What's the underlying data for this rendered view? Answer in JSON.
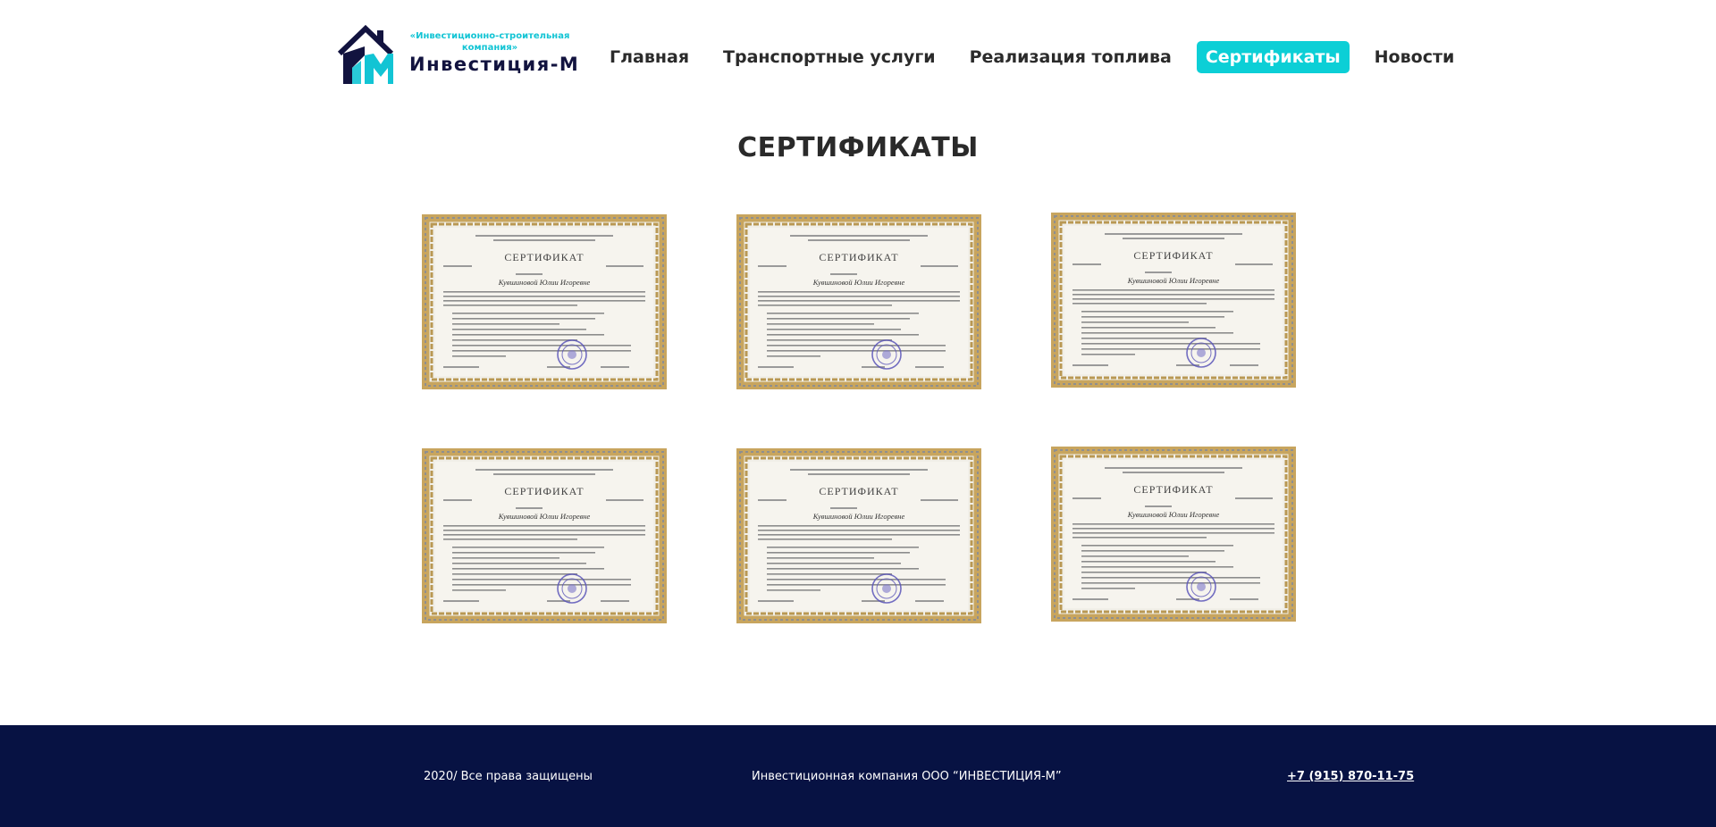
{
  "header": {
    "logo": {
      "subtitle": "«Инвестиционно-строительная компания»",
      "name": "Инвестиция-М"
    },
    "nav": [
      {
        "label": "Главная",
        "active": false
      },
      {
        "label": "Транспортные услуги",
        "active": false
      },
      {
        "label": "Реализация топлива",
        "active": false
      },
      {
        "label": "Сертификаты",
        "active": true
      },
      {
        "label": "Новости",
        "active": false
      }
    ]
  },
  "main": {
    "title": "СЕРТИФИКАТЫ",
    "certificates": [
      {
        "heading": "СЕРТИФИКАТ",
        "name": "Кувшиновой Юлии Игоревне"
      },
      {
        "heading": "СЕРТИФИКАТ",
        "name": "Кувшиновой Юлии Игоревне"
      },
      {
        "heading": "СЕРТИФИКАТ",
        "name": "Кувшиновой Юлии Игоревне"
      },
      {
        "heading": "СЕРТИФИКАТ",
        "name": "Кувшиновой Юлии Игоревне"
      },
      {
        "heading": "СЕРТИФИКАТ",
        "name": "Кувшиновой Юлии Игоревне"
      },
      {
        "heading": "СЕРТИФИКАТ",
        "name": "Кувшиновой Юлии Игоревне"
      }
    ]
  },
  "footer": {
    "copyright": "2020/ Все права защищены",
    "company": "Инвестиционная компания ООО “ИНВЕСТИЦИЯ-М”",
    "phone": "+7 (915) 870-11-75"
  },
  "colors": {
    "accent": "#0ccfd6",
    "footer_bg": "#071243",
    "logo_dark": "#12133f"
  }
}
